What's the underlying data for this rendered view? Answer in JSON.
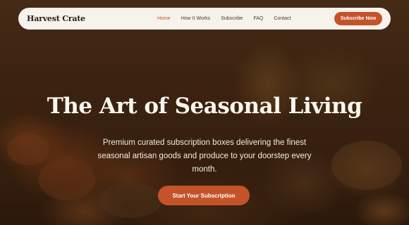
{
  "nav": {
    "logo": "Harvest Crate",
    "links": [
      "Home",
      "How It Works",
      "Subscribe",
      "FAQ",
      "Contact"
    ],
    "active": "Home",
    "cta": "Subscribe Now"
  },
  "hero": {
    "headline": "The Art of Seasonal Living",
    "subheadline": "Premium curated subscription boxes delivering the finest seasonal artisan goods and produce to your doorstep every month.",
    "cta": "Start Your Subscription"
  },
  "colors": {
    "accent": "#c4532a",
    "nav_bg": "#f6f2ec",
    "overlay": "#3b2412"
  }
}
